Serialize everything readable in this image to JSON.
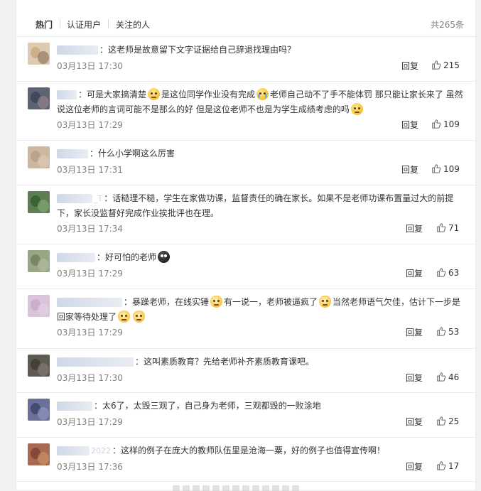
{
  "tabs": {
    "hot": "热门",
    "verified": "认证用户",
    "following": "关注的人",
    "total": "共265条"
  },
  "reply_label": "回复",
  "comments": [
    {
      "user": "",
      "text": "：这老师是故意留下文字证据给自己辞退找理由吗？",
      "time": "03月13日 17:30",
      "likes": "215",
      "avatar_colors": [
        "#c9a57a",
        "#7b6450"
      ]
    },
    {
      "user": "",
      "text_parts": [
        "：可是大家搞清楚",
        "是这位同学作业没有完成",
        "老师自己动不了手不能体罚 那只能让家长来了 虽然说这位老师的言词可能不是那么的好 但是这位老师不也是为学生成绩考虑的吗"
      ],
      "time": "03月13日 17:29",
      "likes": "109",
      "avatar_colors": [
        "#3a3f52",
        "#a68a8f"
      ]
    },
    {
      "user": "",
      "text": "：什么小学啊这么厉害",
      "time": "03月13日 17:31",
      "likes": "109",
      "avatar_colors": [
        "#b39c86",
        "#e1cdb6"
      ]
    },
    {
      "user": "_T",
      "text": "：话糙理不糙，学生在家做功课，监督责任的确在家长。如果不是老师功课布置量过大的前提下，家长没监督好完成作业挨批评也在理。",
      "time": "03月13日 17:34",
      "likes": "71",
      "avatar_colors": [
        "#2f5a2f",
        "#8fb07a"
      ]
    },
    {
      "user": "",
      "text": "：好可怕的老师",
      "time": "03月13日 17:29",
      "likes": "63",
      "avatar_colors": [
        "#6f7d5a",
        "#b8c2a6"
      ]
    },
    {
      "user": "",
      "text_parts": [
        "：暴躁老师，在线实锤",
        "有一说一，老师被逼疯了",
        "当然老师语气欠佳，估计下一步是回家等待处理了"
      ],
      "time": "03月13日 17:29",
      "likes": "53",
      "avatar_colors": [
        "#c7a6c9",
        "#e3d4e6"
      ]
    },
    {
      "user": "",
      "text": "：这叫素质教育？先给老师补齐素质教育课吧。",
      "time": "03月13日 17:30",
      "likes": "46",
      "avatar_colors": [
        "#3c3a36",
        "#8a8478"
      ]
    },
    {
      "user": "",
      "text": "：太6了，太毁三观了，自己身为老师，三观都毁的一败涂地",
      "time": "03月13日 17:29",
      "likes": "25",
      "avatar_colors": [
        "#3a4066",
        "#9aa0c2"
      ]
    },
    {
      "user": "2022",
      "text": "：这样的例子在庞大的教师队伍里是沧海一粟，好的例子也值得宣传啊！",
      "time": "03月13日 17:36",
      "likes": "17",
      "avatar_colors": [
        "#7a3f2f",
        "#d49a6e"
      ]
    }
  ]
}
